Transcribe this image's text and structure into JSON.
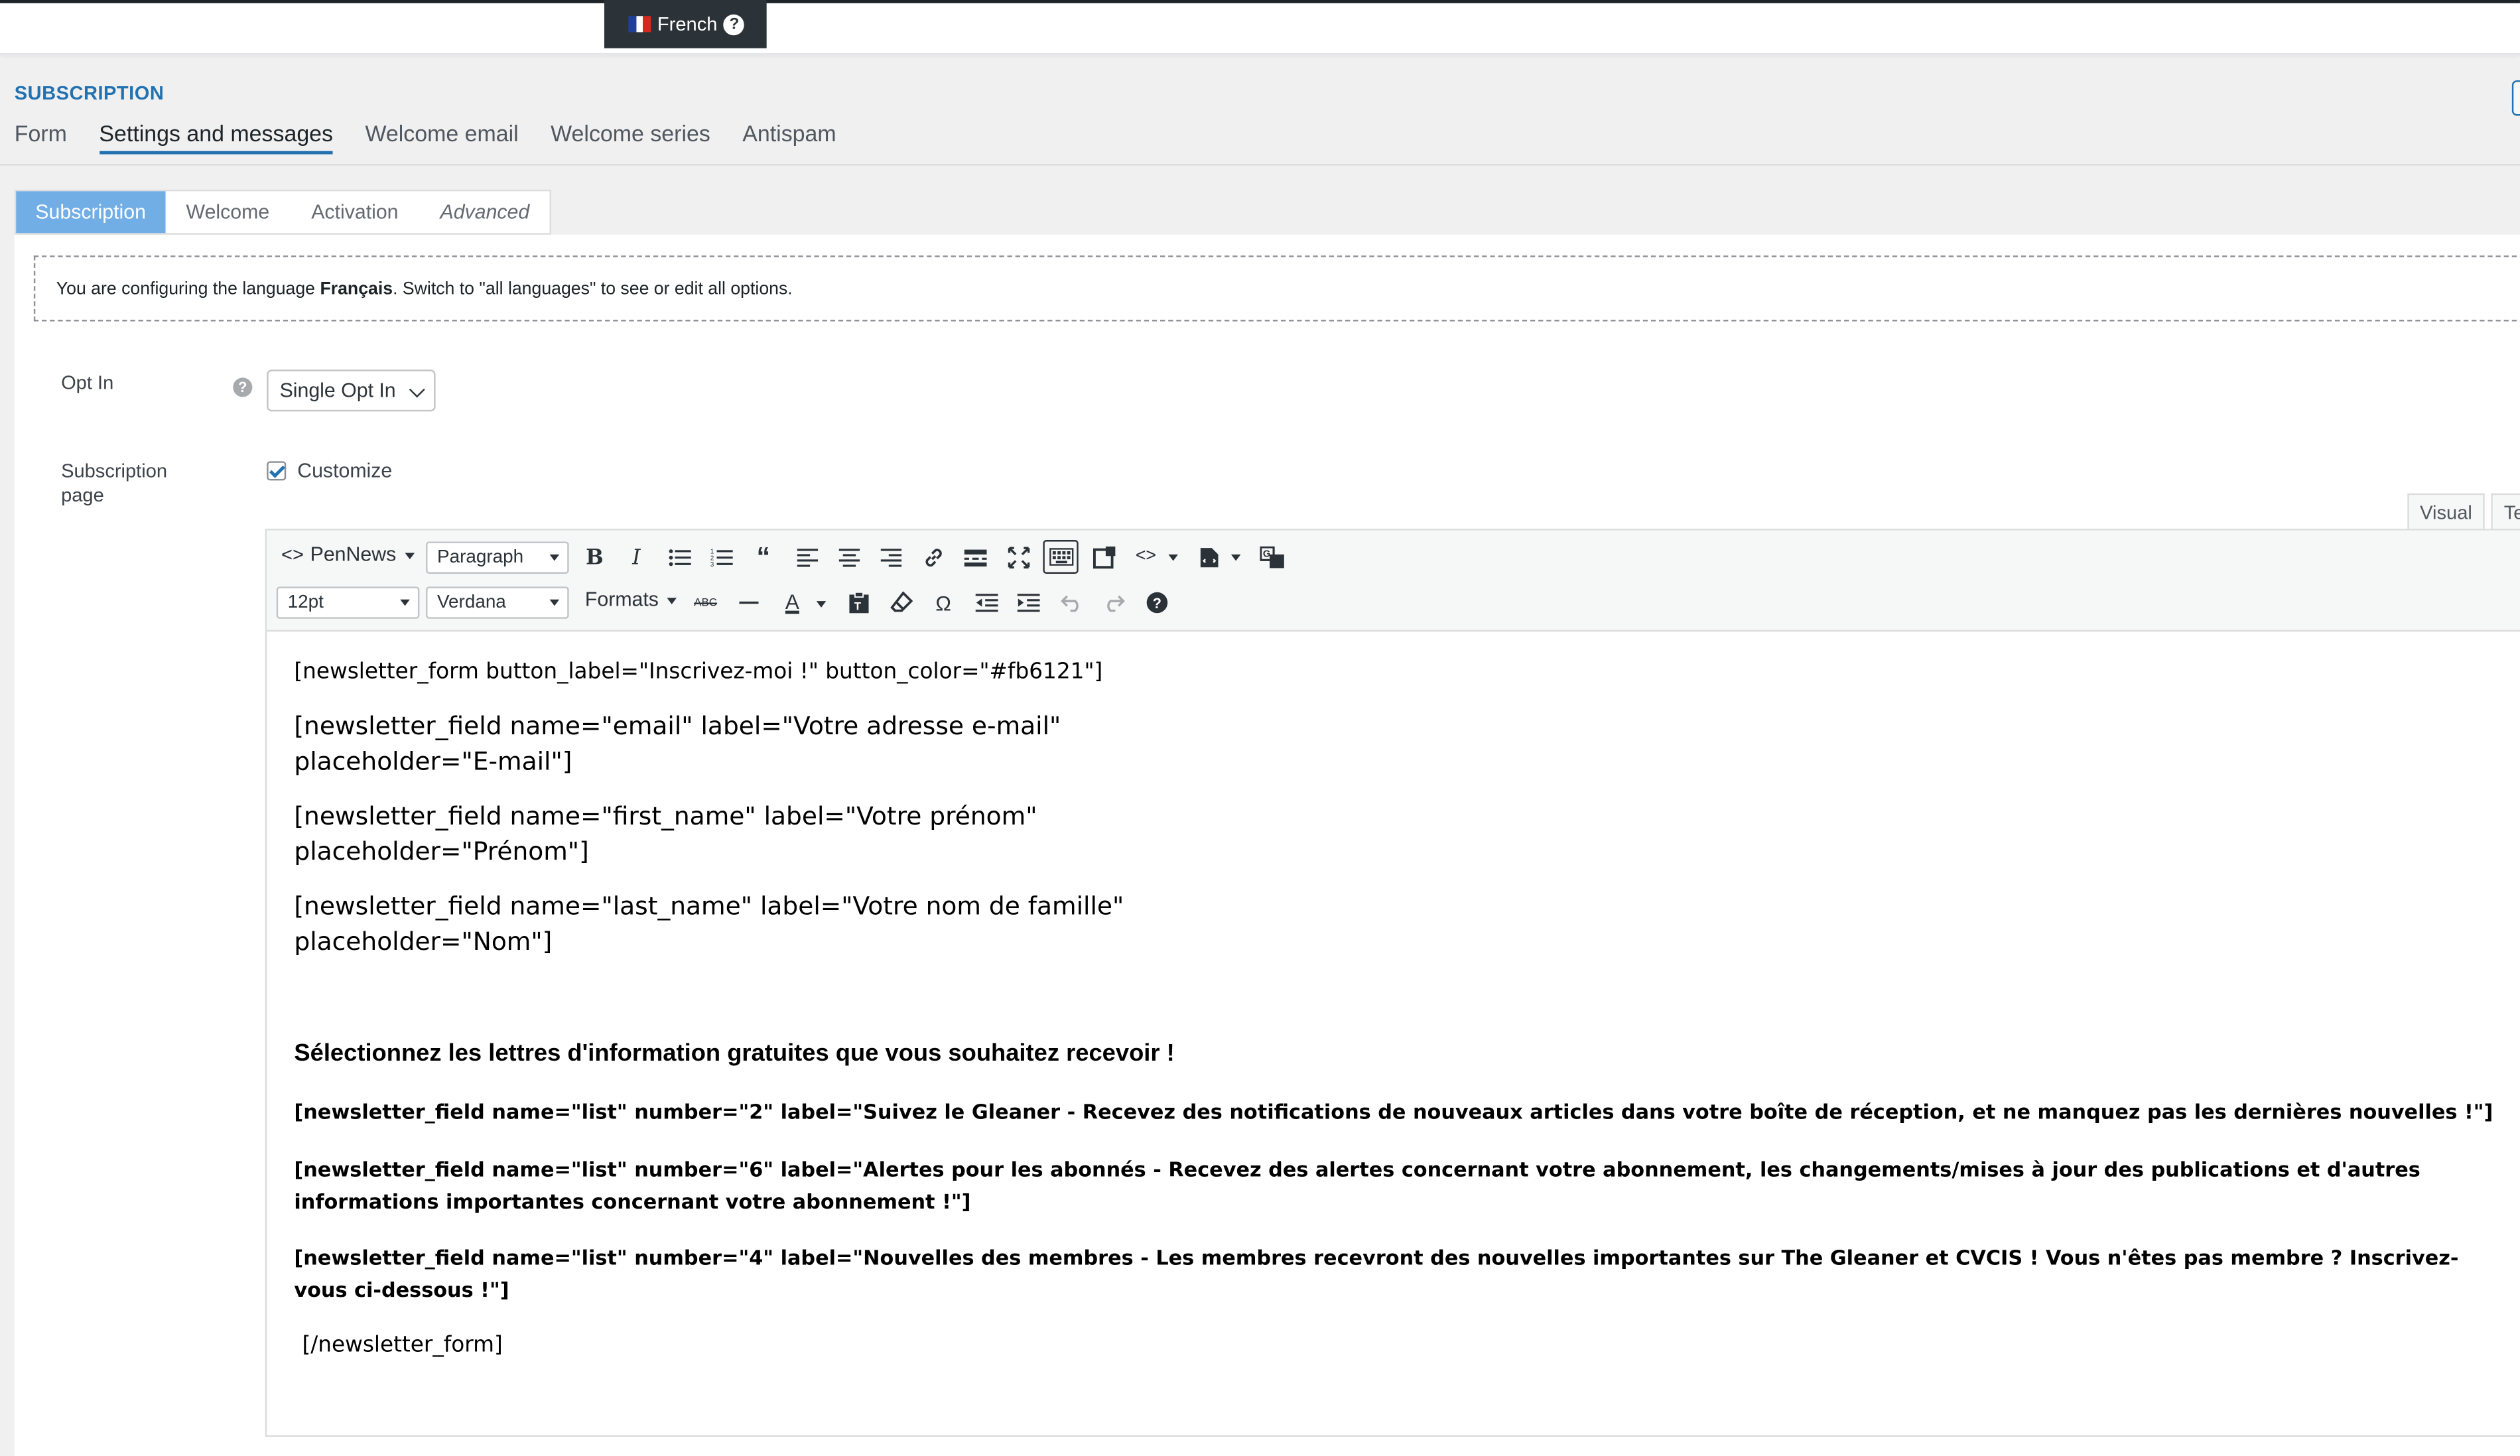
{
  "language_switcher": {
    "label": "French",
    "help": "?"
  },
  "page": {
    "title": "SUBSCRIPTION"
  },
  "main_tabs": [
    {
      "label": "Form"
    },
    {
      "label": "Settings and messages",
      "active": true
    },
    {
      "label": "Welcome email"
    },
    {
      "label": "Welcome series"
    },
    {
      "label": "Antispam"
    }
  ],
  "sub_tabs": [
    {
      "label": "Subscription",
      "active": true
    },
    {
      "label": "Welcome"
    },
    {
      "label": "Activation"
    },
    {
      "label": "Advanced"
    }
  ],
  "notice": {
    "prefix": "You are configuring the language ",
    "language": "Français",
    "suffix": ". Switch to \"all languages\" to see or edit all options."
  },
  "opt_in": {
    "label": "Opt In",
    "help": "?",
    "selected": "Single Opt In"
  },
  "subscription_page": {
    "label_line1": "Subscription",
    "label_line2": "page",
    "customize_label": "Customize",
    "customize_checked": true
  },
  "editor_tabs": {
    "visual": "Visual",
    "text": "Te"
  },
  "toolbar": {
    "pennews": "PenNews",
    "block_format": "Paragraph",
    "font_size": "12pt",
    "font_family": "Verdana",
    "formats": "Formats",
    "strikethrough": "ABC",
    "text_color": "A",
    "special_char": "Ω"
  },
  "content": {
    "line1": "[newsletter_form button_label=\"Inscrivez-moi !\" button_color=\"#fb6121\"]",
    "email_line1": "[newsletter_field name=\"email\" label=\"Votre adresse e-mail\"",
    "email_line2": "placeholder=\"E-mail\"]",
    "first_line1": "[newsletter_field name=\"first_name\" label=\"Votre prénom\"",
    "first_line2": "placeholder=\"Prénom\"]",
    "last_line1": "[newsletter_field name=\"last_name\" label=\"Votre nom de famille\"",
    "last_line2": "placeholder=\"Nom\"]",
    "heading": "Sélectionnez les lettres d'information gratuites que vous souhaitez recevoir !",
    "list2": "[newsletter_field name=\"list\" number=\"2\" label=\"Suivez le Gleaner - Recevez des notifications de nouveaux articles dans votre boîte de réception, et ne manquez pas les dernières nouvelles !\"]",
    "list6_line1": "[newsletter_field name=\"list\" number=\"6\" label=\"Alertes pour les abonnés - Recevez des alertes concernant votre abonnement, les changements/mises à jour des publications et d'autres",
    "list6_line2": "informations importantes concernant votre abonnement !\"]",
    "list4_line1": "[newsletter_field name=\"list\" number=\"4\" label=\"Nouvelles des membres - Les membres recevront des nouvelles importantes sur The Gleaner et CVCIS ! Vous n'êtes pas membre ? Inscrivez-",
    "list4_line2": "vous ci-dessous !\"]",
    "closing": "[/newsletter_form]"
  }
}
